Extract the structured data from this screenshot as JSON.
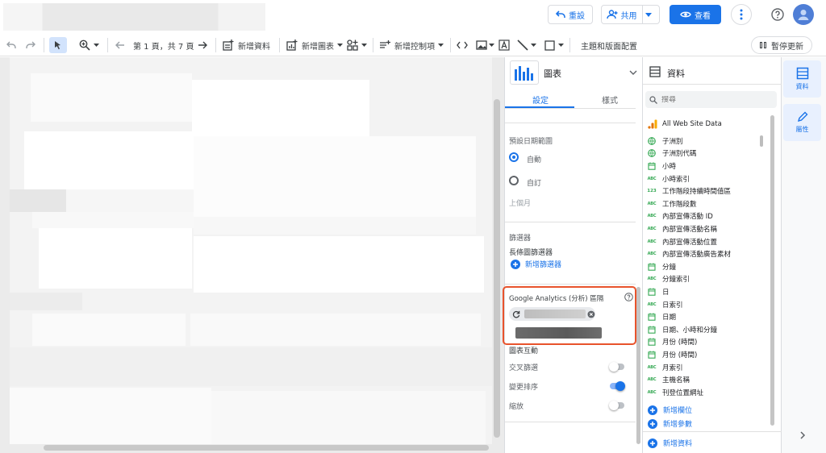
{
  "header": {
    "reset_label": "重設",
    "share_label": "共用",
    "view_label": "查看"
  },
  "toolbar": {
    "page_indicator": "第 1 頁，共 7 頁",
    "add_data": "新增資料",
    "add_chart": "新增圖表",
    "add_control": "新增控制項",
    "theme_layout": "主題和版面配置",
    "pause_update": "暫停更新"
  },
  "chart_panel": {
    "title": "圖表",
    "tabs": [
      "設定",
      "樣式"
    ],
    "date_range_label": "預設日期範圍",
    "auto_label": "自動",
    "custom_label": "自訂",
    "last_month": "上個月",
    "filter_label": "篩選器",
    "long_filter_label": "長條圖篩選器",
    "add_filter": "新增篩選器",
    "ga_segment_label": "Google Analytics (分析) 區隔",
    "chart_interaction_label": "圖表互動",
    "cross_filter": "交叉篩選",
    "change_sort": "變更排序",
    "zoom": "縮放",
    "cross_filter_on": false,
    "change_sort_on": true,
    "zoom_on": false
  },
  "data_panel": {
    "title": "資料",
    "search_placeholder": "搜尋",
    "source_name": "All Web Site Data",
    "fields": [
      {
        "icon": "globe-icon",
        "name": "子洲別"
      },
      {
        "icon": "globe-icon",
        "name": "子洲別代碼"
      },
      {
        "icon": "calendar-icon",
        "name": "小時"
      },
      {
        "icon": "abc-icon",
        "name": "小時索引"
      },
      {
        "icon": "number-icon",
        "name": "工作階段持續時間值區"
      },
      {
        "icon": "abc-icon",
        "name": "工作階段數"
      },
      {
        "icon": "abc-icon",
        "name": "內部宣傳活動 ID"
      },
      {
        "icon": "abc-icon",
        "name": "內部宣傳活動名稱"
      },
      {
        "icon": "abc-icon",
        "name": "內部宣傳活動位置"
      },
      {
        "icon": "abc-icon",
        "name": "內部宣傳活動廣告素材"
      },
      {
        "icon": "calendar-icon",
        "name": "分鐘"
      },
      {
        "icon": "abc-icon",
        "name": "分鐘索引"
      },
      {
        "icon": "calendar-icon",
        "name": "日"
      },
      {
        "icon": "abc-icon",
        "name": "日索引"
      },
      {
        "icon": "calendar-icon",
        "name": "日期"
      },
      {
        "icon": "calendar-icon",
        "name": "日期、小時和分鐘"
      },
      {
        "icon": "calendar-icon",
        "name": "月份 (時間)"
      },
      {
        "icon": "calendar-icon",
        "name": "月份 (時間)"
      },
      {
        "icon": "abc-icon",
        "name": "月索引"
      },
      {
        "icon": "abc-icon",
        "name": "主機名稱"
      },
      {
        "icon": "abc-icon",
        "name": "刊登位置網址"
      }
    ],
    "add_field": "新增欄位",
    "add_param": "新增參數",
    "add_data": "新增資料"
  },
  "side_tabs": {
    "data": "資料",
    "properties": "屬性"
  },
  "colors": {
    "accent": "#1a73e8",
    "highlight_border": "#e8532c"
  }
}
